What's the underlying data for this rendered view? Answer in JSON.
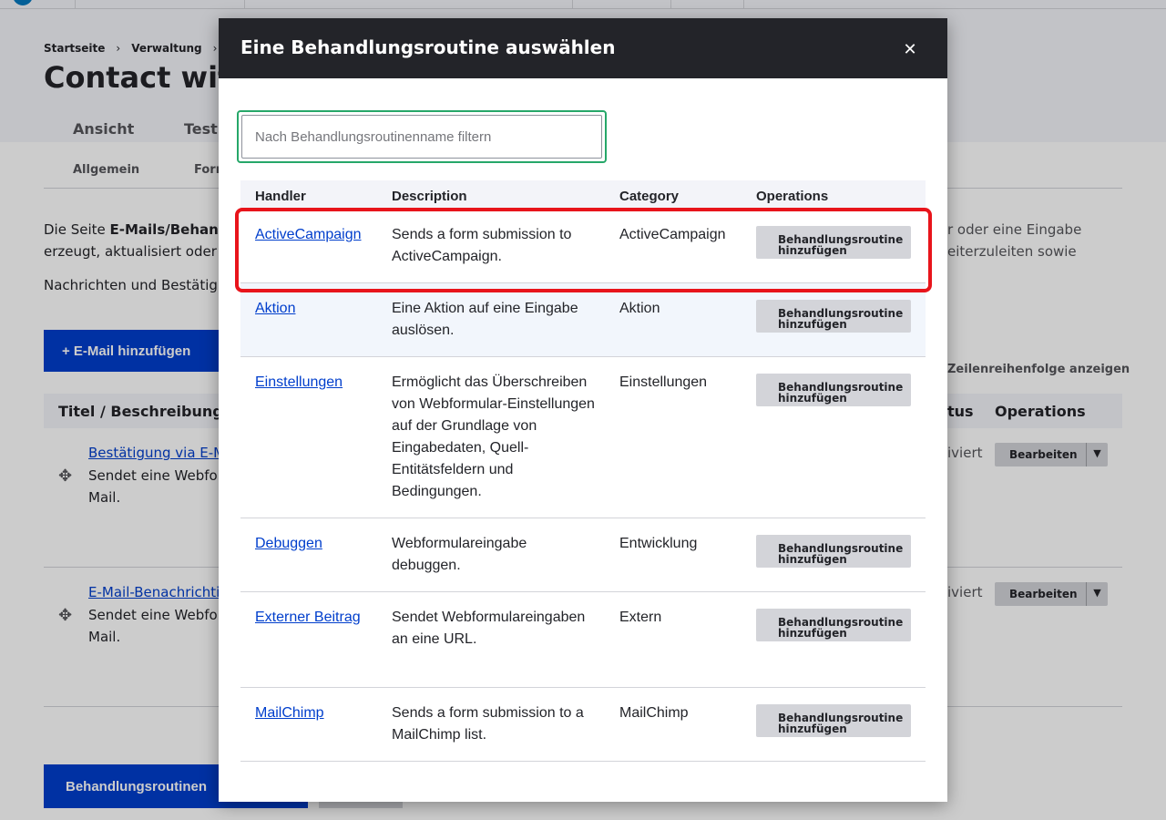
{
  "background": {
    "breadcrumb": [
      "Startseite",
      "Verwaltung"
    ],
    "page_title": "Contact with",
    "primary_tabs": [
      "Ansicht",
      "Test"
    ],
    "secondary_tabs": [
      "Allgemein",
      "Forr"
    ],
    "intro_prefix": "Die Seite ",
    "intro_bold": "E-Mails/Behandl",
    "intro_line2": "erzeugt, aktualisiert oder g",
    "intro_right_line1": "r oder eine Eingabe",
    "intro_right_line2": "eiterzuleiten sowie",
    "intro2": "Nachrichten und Bestätigu",
    "add_email_label": "+ E-Mail hinzufügen",
    "show_row_weights": "Zeilenreihenfolge anzeigen",
    "table_head": {
      "title": "Titel / Beschreibung",
      "status": "tus",
      "operations": "Operations"
    },
    "rows": [
      {
        "link": "Bestätigung via E-M",
        "desc": "Sendet eine Webfor Mail.",
        "status": "iviert",
        "edit": "Bearbeiten"
      },
      {
        "link": "E-Mail-Benachrichtig",
        "desc": "Sendet eine Webfor Mail.",
        "status": "iviert",
        "edit": "Bearbeiten"
      }
    ],
    "routines_button": "Behandlungsroutinen"
  },
  "modal": {
    "title": "Eine Behandlungsroutine auswählen",
    "close_glyph": "✕",
    "filter_placeholder": "Nach Behandlungsroutinenname filtern",
    "filter_value": "",
    "columns": [
      "Handler",
      "Description",
      "Category",
      "Operations"
    ],
    "handlers": [
      {
        "name": "ActiveCampaign",
        "description": "Sends a form submission to ActiveCampaign.",
        "category": "ActiveCampaign",
        "operation": "Behandlungsroutine\nhinzufügen"
      },
      {
        "name": "Aktion",
        "description": "Eine Aktion auf eine Eingabe auslösen.",
        "category": "Aktion",
        "operation": "Behandlungsroutine\nhinzufügen"
      },
      {
        "name": "Einstellungen",
        "description": "Ermöglicht das Überschreiben von Webformular-Einstellungen auf der Grundlage von Eingabedaten, Quell-Entitätsfeldern und Bedingungen.",
        "category": "Einstellungen",
        "operation": "Behandlungsroutine\nhinzufügen"
      },
      {
        "name": "Debuggen",
        "description": "Webformulareingabe debuggen.",
        "category": "Entwicklung",
        "operation": "Behandlungsroutine\nhinzufügen"
      },
      {
        "name": "Externer Beitrag",
        "description": "Sendet Webformulareingaben an eine URL.",
        "category": "Extern",
        "operation": "Behandlungsroutine\nhinzufügen"
      },
      {
        "name": "MailChimp",
        "description": "Sends a form submission to a MailChimp list.",
        "category": "MailChimp",
        "operation": "Behandlungsroutine\nhinzufügen"
      }
    ]
  },
  "colors": {
    "link": "#003ecc",
    "primary_button": "#003ecc",
    "modal_header": "#232429",
    "filter_focus": "#26a769",
    "highlight": "#e8141b"
  }
}
